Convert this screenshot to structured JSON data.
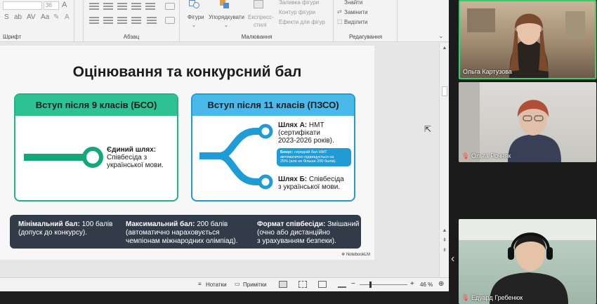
{
  "ribbon": {
    "groups": {
      "font": "Шрифт",
      "paragraph": "Абзац",
      "drawing": "Малювання",
      "editing": "Редагування"
    },
    "font_size": "36",
    "buttons": {
      "shapes": "Фігури",
      "arrange": "Упорядкувати",
      "quick_styles_1": "Експресс-",
      "quick_styles_2": "стилі",
      "shape_fill": "Заливка фігури",
      "shape_outline": "Контур фігури",
      "shape_effects": "Ефекти для фігур",
      "find": "Знайти",
      "replace": "Замінити",
      "select": "Виділити"
    }
  },
  "slide": {
    "title": "Оцінювання та конкурсний бал",
    "left_card": {
      "header": "Вступ після 9 класів (БСО)",
      "path_bold": "Єдиний шлях:",
      "path_text_1": "Співбесіда з",
      "path_text_2": "української мови."
    },
    "right_card": {
      "header": "Вступ після 11 класів (ПЗСО)",
      "path_a_bold": "Шлях А:",
      "path_a_1": "НМТ",
      "path_a_2": "(сертифікати",
      "path_a_3": "2023-2026 років).",
      "bonus_bold": "Бонус:",
      "bonus_1": "середній бал НМТ",
      "bonus_2": "автоматично підвищується на",
      "bonus_3": "25% (але не більше 200 балів).",
      "path_b_bold": "Шлях Б:",
      "path_b_1": "Співбесіда",
      "path_b_2": "з української мови."
    },
    "info": [
      {
        "label": "Мінімальний бал:",
        "value": "100 балів",
        "line2": "(допуск до конкурсу).",
        "line3": ""
      },
      {
        "label": "Максимальний бал:",
        "value": "200 балів",
        "line2": "(автоматично нараховується",
        "line3": "чемпіонам міжнародних олімпіад)."
      },
      {
        "label": "Формат співбесіди:",
        "value": "Змішаний",
        "line2": "(очно або дистанційно",
        "line3": "з урахуванням безпеки)."
      }
    ],
    "badge": "NotebookLM"
  },
  "status": {
    "notes": "Нотатки",
    "comments": "Примітки",
    "zoom": "46 %"
  },
  "participants": [
    {
      "name": "Ольга Картузова",
      "muted": false
    },
    {
      "name": "Ольга Рочняк",
      "muted": true
    },
    {
      "name": "Едуард Гребенюк",
      "muted": true
    }
  ],
  "colors": {
    "green_head": "#2ec193",
    "green_line": "#14a77c",
    "blue_head": "#4bb8ea",
    "blue_line": "#1f9bd6",
    "info_bar": "#323c48",
    "active_speaker": "#2fd36b"
  }
}
